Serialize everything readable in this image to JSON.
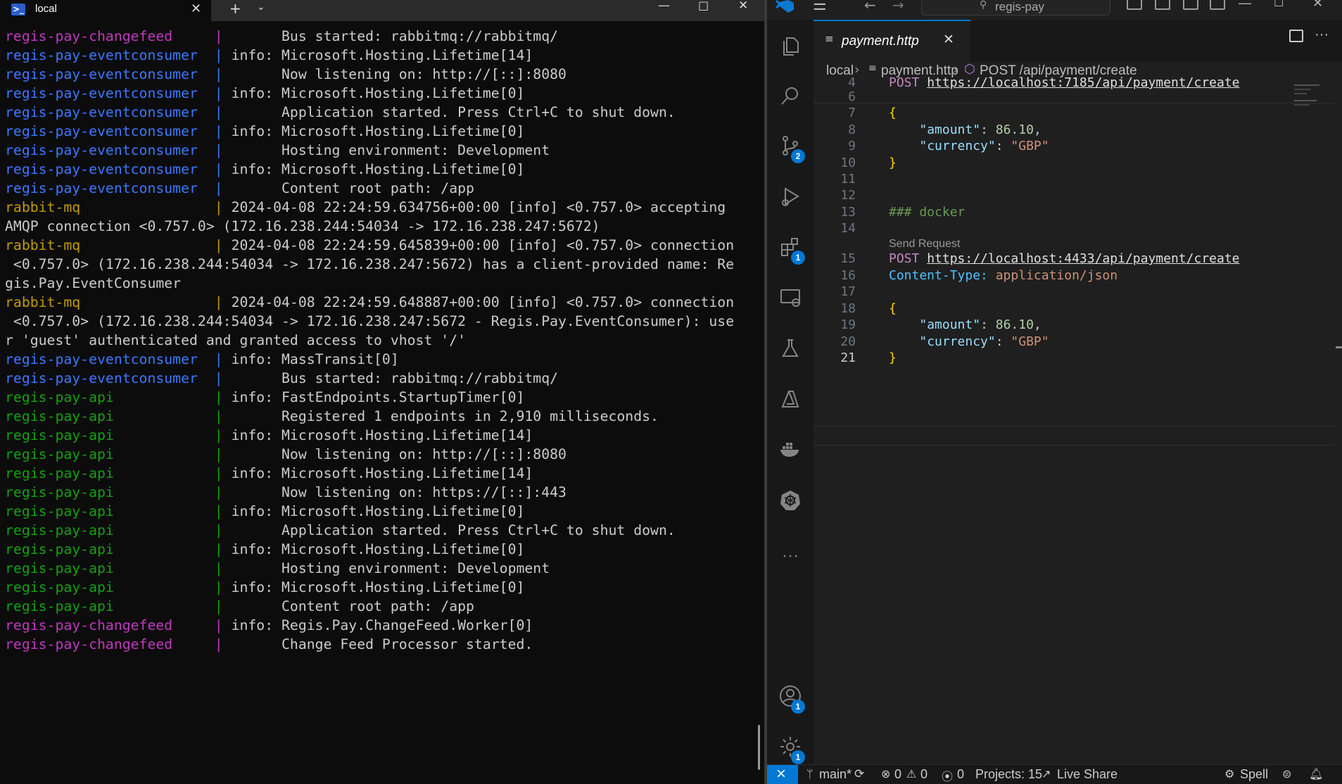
{
  "terminal": {
    "tab_title": "local",
    "new_tab_label": "+",
    "lines": [
      {
        "src": "regis-pay-changefeed     ",
        "bar": "| ",
        "text": "      Bus started: rabbitmq://rabbitmq/",
        "color": "magenta"
      },
      {
        "src": "regis-pay-eventconsumer  ",
        "bar": "| ",
        "text": "info: Microsoft.Hosting.Lifetime[14]",
        "color": "blue"
      },
      {
        "src": "regis-pay-eventconsumer  ",
        "bar": "| ",
        "text": "      Now listening on: http://[::]:8080",
        "color": "blue"
      },
      {
        "src": "regis-pay-eventconsumer  ",
        "bar": "| ",
        "text": "info: Microsoft.Hosting.Lifetime[0]",
        "color": "blue"
      },
      {
        "src": "regis-pay-eventconsumer  ",
        "bar": "| ",
        "text": "      Application started. Press Ctrl+C to shut down.",
        "color": "blue"
      },
      {
        "src": "regis-pay-eventconsumer  ",
        "bar": "| ",
        "text": "info: Microsoft.Hosting.Lifetime[0]",
        "color": "blue"
      },
      {
        "src": "regis-pay-eventconsumer  ",
        "bar": "| ",
        "text": "      Hosting environment: Development",
        "color": "blue"
      },
      {
        "src": "regis-pay-eventconsumer  ",
        "bar": "| ",
        "text": "info: Microsoft.Hosting.Lifetime[0]",
        "color": "blue"
      },
      {
        "src": "regis-pay-eventconsumer  ",
        "bar": "| ",
        "text": "      Content root path: /app",
        "color": "blue"
      },
      {
        "src": "rabbit-mq                ",
        "bar": "| ",
        "text": "2024-04-08 22:24:59.634756+00:00 [info] <0.757.0> accepting",
        "color": "yellow"
      },
      {
        "src": "",
        "bar": "",
        "text": "AMQP connection <0.757.0> (172.16.238.244:54034 -> 172.16.238.247:5672)",
        "color": "none"
      },
      {
        "src": "rabbit-mq                ",
        "bar": "| ",
        "text": "2024-04-08 22:24:59.645839+00:00 [info] <0.757.0> connection",
        "color": "yellow"
      },
      {
        "src": "",
        "bar": "",
        "text": " <0.757.0> (172.16.238.244:54034 -> 172.16.238.247:5672) has a client-provided name: Re",
        "color": "none"
      },
      {
        "src": "",
        "bar": "",
        "text": "gis.Pay.EventConsumer",
        "color": "none"
      },
      {
        "src": "rabbit-mq                ",
        "bar": "| ",
        "text": "2024-04-08 22:24:59.648887+00:00 [info] <0.757.0> connection",
        "color": "yellow"
      },
      {
        "src": "",
        "bar": "",
        "text": " <0.757.0> (172.16.238.244:54034 -> 172.16.238.247:5672 - Regis.Pay.EventConsumer): use",
        "color": "none"
      },
      {
        "src": "",
        "bar": "",
        "text": "r 'guest' authenticated and granted access to vhost '/'",
        "color": "none"
      },
      {
        "src": "regis-pay-eventconsumer  ",
        "bar": "| ",
        "text": "info: MassTransit[0]",
        "color": "blue"
      },
      {
        "src": "regis-pay-eventconsumer  ",
        "bar": "| ",
        "text": "      Bus started: rabbitmq://rabbitmq/",
        "color": "blue"
      },
      {
        "src": "regis-pay-api            ",
        "bar": "| ",
        "text": "info: FastEndpoints.StartupTimer[0]",
        "color": "green"
      },
      {
        "src": "regis-pay-api            ",
        "bar": "| ",
        "text": "      Registered 1 endpoints in 2,910 milliseconds.",
        "color": "green"
      },
      {
        "src": "regis-pay-api            ",
        "bar": "| ",
        "text": "info: Microsoft.Hosting.Lifetime[14]",
        "color": "green"
      },
      {
        "src": "regis-pay-api            ",
        "bar": "| ",
        "text": "      Now listening on: http://[::]:8080",
        "color": "green"
      },
      {
        "src": "regis-pay-api            ",
        "bar": "| ",
        "text": "info: Microsoft.Hosting.Lifetime[14]",
        "color": "green"
      },
      {
        "src": "regis-pay-api            ",
        "bar": "| ",
        "text": "      Now listening on: https://[::]:443",
        "color": "green"
      },
      {
        "src": "regis-pay-api            ",
        "bar": "| ",
        "text": "info: Microsoft.Hosting.Lifetime[0]",
        "color": "green"
      },
      {
        "src": "regis-pay-api            ",
        "bar": "| ",
        "text": "      Application started. Press Ctrl+C to shut down.",
        "color": "green"
      },
      {
        "src": "regis-pay-api            ",
        "bar": "| ",
        "text": "info: Microsoft.Hosting.Lifetime[0]",
        "color": "green"
      },
      {
        "src": "regis-pay-api            ",
        "bar": "| ",
        "text": "      Hosting environment: Development",
        "color": "green"
      },
      {
        "src": "regis-pay-api            ",
        "bar": "| ",
        "text": "info: Microsoft.Hosting.Lifetime[0]",
        "color": "green"
      },
      {
        "src": "regis-pay-api            ",
        "bar": "| ",
        "text": "      Content root path: /app",
        "color": "green"
      },
      {
        "src": "regis-pay-changefeed     ",
        "bar": "| ",
        "text": "info: Regis.Pay.ChangeFeed.Worker[0]",
        "color": "magenta"
      },
      {
        "src": "regis-pay-changefeed     ",
        "bar": "| ",
        "text": "      Change Feed Processor started.",
        "color": "magenta"
      }
    ]
  },
  "vscode": {
    "search_text": "regis-pay",
    "tab_title": "payment.http",
    "breadcrumb": {
      "folder": "local",
      "file": "payment.http",
      "symbol": "POST /api/payment/create"
    },
    "codelens": "Send Request",
    "badges": {
      "source_control": "2",
      "extensions": "1",
      "accounts": "1",
      "settings": "1"
    },
    "code": [
      {
        "n": "4",
        "parts": [
          [
            "k-post",
            "POST "
          ],
          [
            "k-url",
            "https://localhost:7185/api/payment/create"
          ]
        ]
      },
      {
        "n": "6",
        "parts": []
      },
      {
        "n": "7",
        "parts": [
          [
            "k-brace",
            "{"
          ]
        ]
      },
      {
        "n": "8",
        "parts": [
          [
            "",
            "    "
          ],
          [
            "k-key",
            "\"amount\""
          ],
          [
            "",
            ": "
          ],
          [
            "k-num",
            "86.10"
          ],
          [
            "",
            ","
          ]
        ]
      },
      {
        "n": "9",
        "parts": [
          [
            "",
            "    "
          ],
          [
            "k-key",
            "\"currency\""
          ],
          [
            "",
            ": "
          ],
          [
            "k-str",
            "\"GBP\""
          ]
        ]
      },
      {
        "n": "10",
        "parts": [
          [
            "k-brace",
            "}"
          ]
        ]
      },
      {
        "n": "11",
        "parts": []
      },
      {
        "n": "12",
        "parts": []
      },
      {
        "n": "13",
        "parts": [
          [
            "k-comment",
            "### docker"
          ]
        ]
      },
      {
        "n": "14",
        "parts": []
      },
      {
        "n": "15",
        "parts": [
          [
            "k-post",
            "POST "
          ],
          [
            "k-url",
            "https://localhost:4433/api/payment/create"
          ]
        ]
      },
      {
        "n": "16",
        "parts": [
          [
            "k-hkey",
            "Content-Type: "
          ],
          [
            "k-hval",
            "application/json"
          ]
        ]
      },
      {
        "n": "17",
        "parts": []
      },
      {
        "n": "18",
        "parts": [
          [
            "k-brace",
            "{"
          ]
        ]
      },
      {
        "n": "19",
        "parts": [
          [
            "",
            "    "
          ],
          [
            "k-key",
            "\"amount\""
          ],
          [
            "",
            ": "
          ],
          [
            "k-num",
            "86.10"
          ],
          [
            "",
            ","
          ]
        ]
      },
      {
        "n": "20",
        "parts": [
          [
            "",
            "    "
          ],
          [
            "k-key",
            "\"currency\""
          ],
          [
            "",
            ": "
          ],
          [
            "k-str",
            "\"GBP\""
          ]
        ]
      },
      {
        "n": "21",
        "parts": [
          [
            "k-brace",
            "}"
          ]
        ]
      }
    ],
    "status": {
      "branch": "main*",
      "errors": "0",
      "warnings": "0",
      "ports": "0",
      "projects": "Projects: 15",
      "live_share": "Live Share",
      "spell": "Spell"
    }
  },
  "colors": {
    "accent": "#0078d4",
    "term_magenta": "#c038c0",
    "term_blue": "#3b78ff",
    "term_yellow": "#c19c00",
    "term_green": "#13a10e"
  }
}
